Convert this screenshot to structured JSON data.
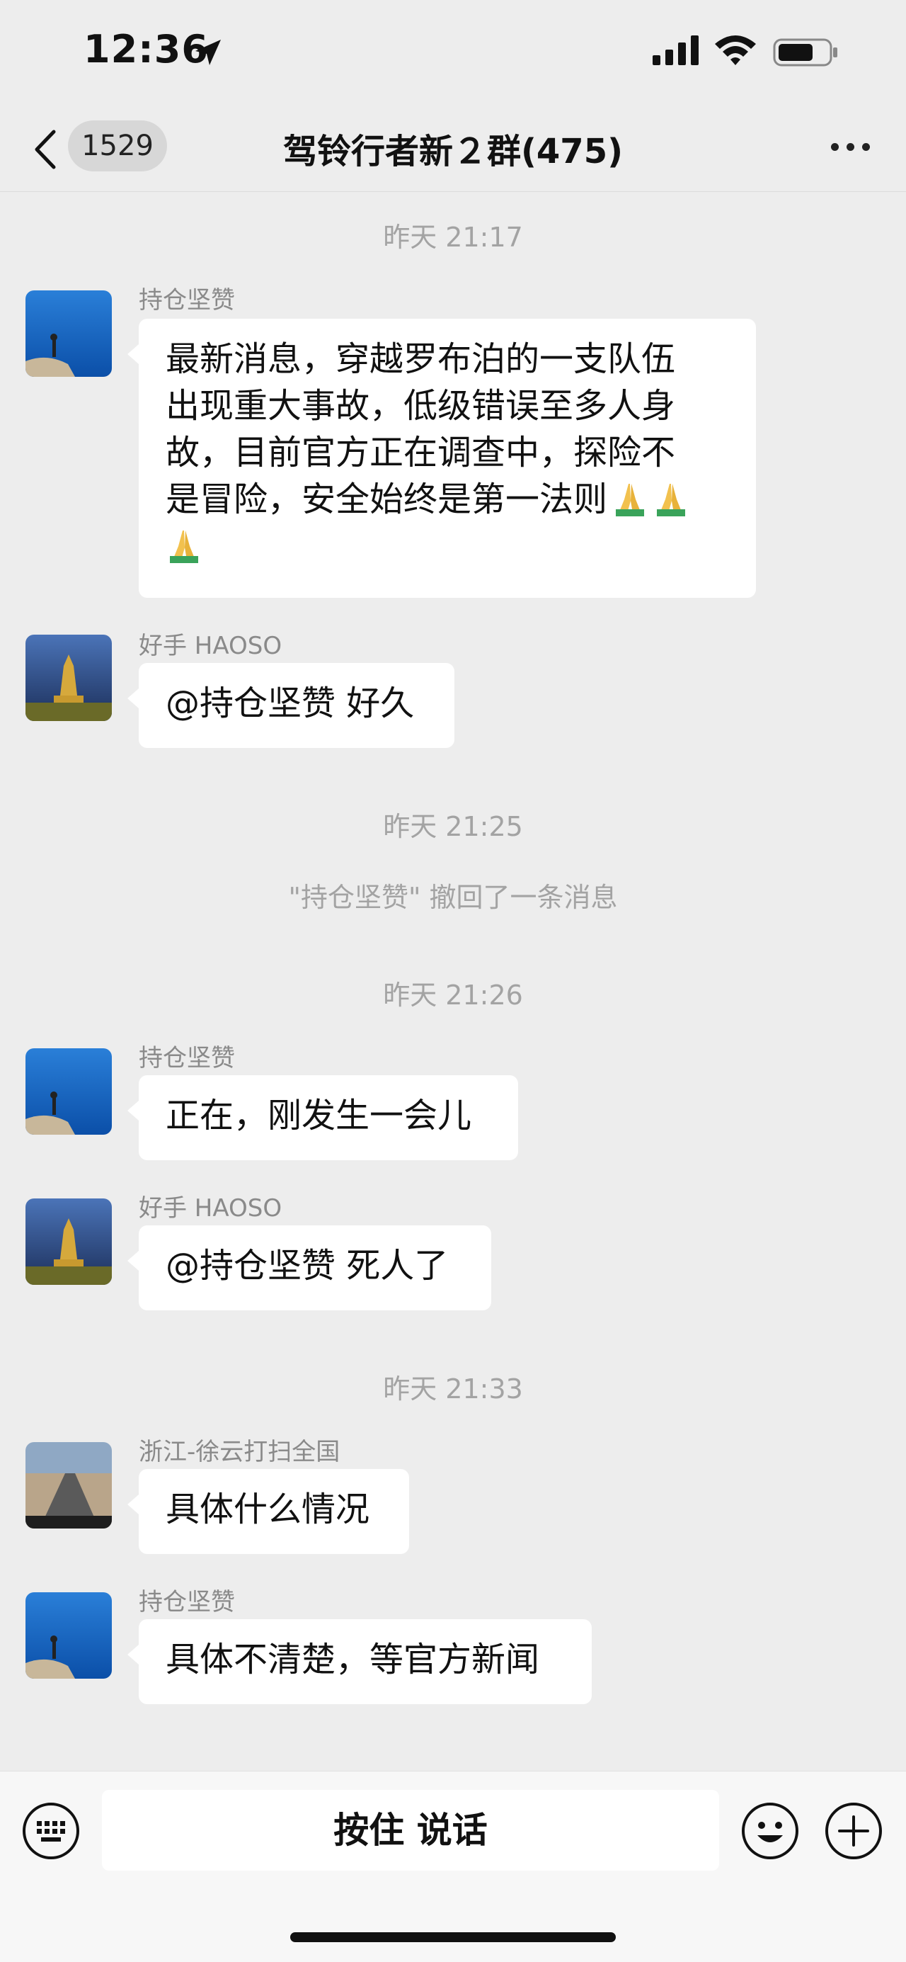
{
  "status_bar": {
    "time": "12:36"
  },
  "header": {
    "back_count": "1529",
    "title": "驾铃行者新２群(475)"
  },
  "messages": {
    "ts1": "昨天 21:17",
    "m1_nick": "持仓坚赞",
    "m1_l1": "最新消息，穿越罗布泊的一支队伍",
    "m1_l2": "出现重大事故，低级错误至多人身",
    "m1_l3": "故，目前官方正在调查中，探险不",
    "m1_l4": "是冒险，安全始终是第一法则",
    "m1_emoji": "folded-hands-icon",
    "m2_nick": "好手 HAOSO",
    "m2_text": "@持仓坚赞 好久",
    "ts2": "昨天 21:25",
    "recall": "\"持仓坚赞\" 撤回了一条消息",
    "ts3": "昨天 21:26",
    "m3_nick": "持仓坚赞",
    "m3_text": "正在，刚发生一会儿",
    "m4_nick": "好手 HAOSO",
    "m4_text": "@持仓坚赞 死人了",
    "ts4": "昨天 21:33",
    "m5_nick": "浙江-徐云打扫全国",
    "m5_text": "具体什么情况",
    "m6_nick": "持仓坚赞",
    "m6_text": "具体不清楚，等官方新闻"
  },
  "input_bar": {
    "talk_label": "按住 说话"
  },
  "colors": {
    "background": "#ededed",
    "bubble": "#ffffff",
    "timestamp": "#a3a3a3",
    "nickname": "#8a8a8a"
  }
}
